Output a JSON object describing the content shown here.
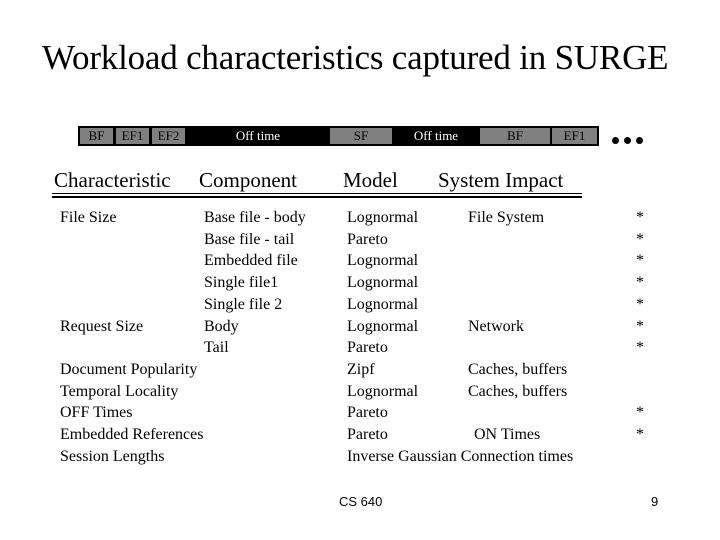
{
  "title": "Workload characteristics captured in SURGE",
  "timeline": {
    "segments": [
      {
        "label": "BF",
        "style": "gray"
      },
      {
        "label": "EF1",
        "style": "gray"
      },
      {
        "label": "EF2",
        "style": "gray"
      },
      {
        "label": "Off time",
        "style": "dark"
      },
      {
        "label": "SF",
        "style": "gray"
      },
      {
        "label": "Off time",
        "style": "dark"
      },
      {
        "label": "BF",
        "style": "gray"
      },
      {
        "label": "EF1",
        "style": "gray"
      }
    ],
    "continuation": "ellipsis-dots"
  },
  "table": {
    "headers": [
      "Characteristic",
      "Component",
      "Model",
      "System Impact"
    ],
    "rows": [
      {
        "characteristic": "File Size",
        "component": "Base file - body",
        "model": "Lognormal",
        "impact": "File System",
        "star": "*"
      },
      {
        "characteristic": "",
        "component": "Base file - tail",
        "model": "Pareto",
        "impact": "",
        "star": "*"
      },
      {
        "characteristic": "",
        "component": "Embedded file",
        "model": "Lognormal",
        "impact": "",
        "star": "*"
      },
      {
        "characteristic": "",
        "component": "Single file1",
        "model": "Lognormal",
        "impact": "",
        "star": "*"
      },
      {
        "characteristic": "",
        "component": "Single file 2",
        "model": "Lognormal",
        "impact": "",
        "star": "*"
      },
      {
        "characteristic": "Request Size",
        "component": "Body",
        "model": "Lognormal",
        "impact": "Network",
        "star": "*"
      },
      {
        "characteristic": "",
        "component": "Tail",
        "model": "Pareto",
        "impact": "",
        "star": "*"
      },
      {
        "characteristic": "Document Popularity",
        "component": "",
        "model": "Zipf",
        "impact": "Caches, buffers",
        "star": ""
      },
      {
        "characteristic": "Temporal Locality",
        "component": "",
        "model": "Lognormal",
        "impact": "Caches, buffers",
        "star": ""
      },
      {
        "characteristic": "OFF Times",
        "component": "",
        "model": "Pareto",
        "impact": "",
        "star": "*"
      },
      {
        "characteristic": "Embedded References",
        "component": "",
        "model": "Pareto",
        "impact": "ON Times",
        "star": "*"
      },
      {
        "characteristic": "Session Lengths",
        "component": "",
        "model": "Inverse Gaussian Connection times",
        "impact": "",
        "star": ""
      }
    ]
  },
  "footer": {
    "course": "CS 640",
    "page_number": "9"
  }
}
